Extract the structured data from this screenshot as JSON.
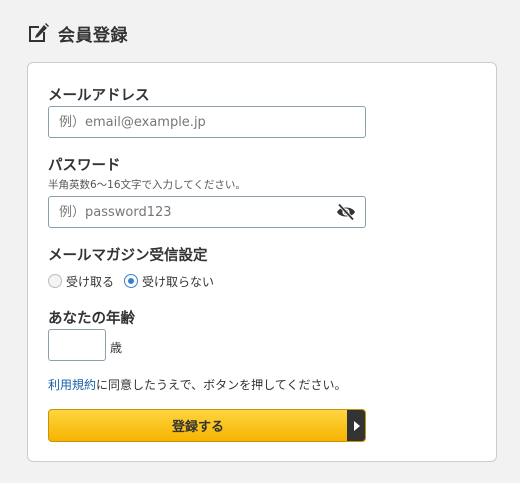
{
  "header": {
    "title": "会員登録",
    "icon": "edit-icon"
  },
  "form": {
    "email": {
      "label": "メールアドレス",
      "placeholder": "例）email@example.jp",
      "value": ""
    },
    "password": {
      "label": "パスワード",
      "hint": "半角英数6〜16文字で入力してください。",
      "placeholder": "例）password123",
      "value": "",
      "toggle_icon": "eye-off-icon"
    },
    "newsletter": {
      "label": "メールマガジン受信設定",
      "options": [
        {
          "label": "受け取る",
          "checked": false
        },
        {
          "label": "受け取らない",
          "checked": true
        }
      ]
    },
    "age": {
      "label": "あなたの年齢",
      "value": "",
      "unit": "歳"
    },
    "terms": {
      "link_text": "利用規約",
      "text": "に同意したうえで、ボタンを押してください。"
    },
    "submit": {
      "label": "登録する"
    }
  },
  "colors": {
    "accent": "#f6b400",
    "link": "#1a5fa8",
    "radio_checked": "#3a80c8"
  }
}
